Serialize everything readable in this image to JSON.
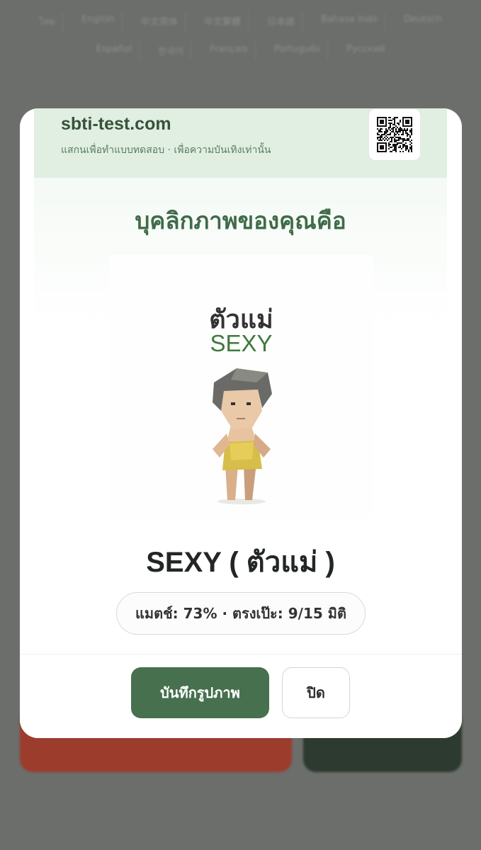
{
  "background": {
    "languages_row1": [
      "ไทย",
      "English",
      "中文简体",
      "中文繁體",
      "日本語",
      "Bahasa Indo",
      "Deutsch"
    ],
    "languages_row2": [
      "Español",
      "한국어",
      "Français",
      "Português",
      "Русский"
    ]
  },
  "modal": {
    "site": "sbti-test.com",
    "site_subtitle": "แสกนเพื่อทำแบบทดสอบ · เพื่อความบันเทิงเท่านั้น",
    "heading": "บุคลิกภาพของคุณคือ",
    "image_title_thai": "ตัวแม่",
    "image_title_en": "SEXY",
    "result_name": "SEXY ( ตัวแม่ )",
    "stats": "แมตช์: 73% · ตรงเป๊ะ: 9/15 มิติ",
    "save_label": "บันทึกรูปภาพ",
    "close_label": "ปิด"
  },
  "colors": {
    "accent": "#46704e",
    "header_bg": "#e0efe2",
    "heading": "#3f6b49"
  },
  "icons": [
    "qr-code-icon"
  ]
}
